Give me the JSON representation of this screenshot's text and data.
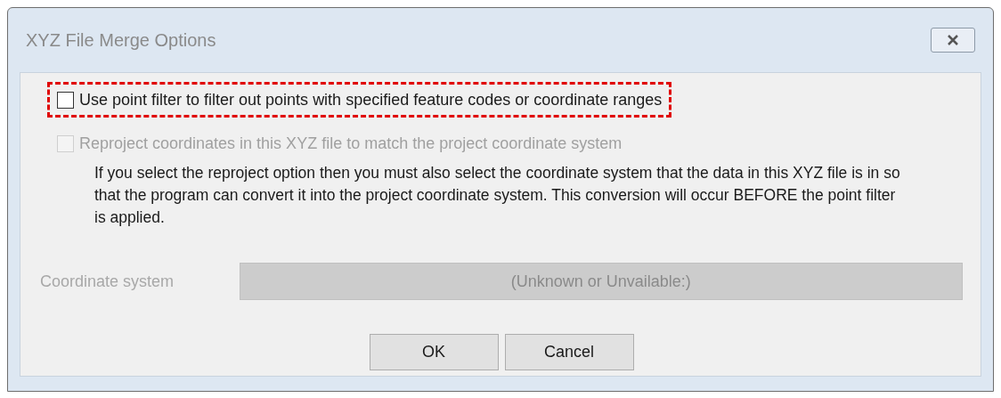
{
  "window": {
    "title": "XYZ File Merge Options"
  },
  "options": [
    {
      "label": "Use point filter to filter out points with specified feature codes or coordinate ranges",
      "checked": false,
      "disabled": false,
      "highlighted": true
    },
    {
      "label": "Reproject coordinates in this XYZ file to match the project coordinate system",
      "checked": false,
      "disabled": true,
      "highlighted": false
    }
  ],
  "note": "If you select the reproject option then you must also select the coordinate system that the data in this XYZ file is in so that the program can convert it into the project coordinate system.  This conversion will occur BEFORE the point filter is applied.",
  "coordinate_system": {
    "label": "Coordinate system",
    "value": "(Unknown or Unvailable:)",
    "disabled": true
  },
  "buttons": [
    "OK",
    "Cancel"
  ]
}
